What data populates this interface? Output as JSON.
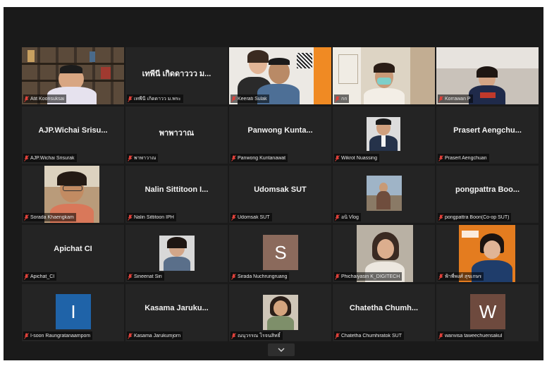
{
  "participants": [
    {
      "display": "",
      "label": "Atit Koonsuksai",
      "kind": "video-bookshelf",
      "active": true
    },
    {
      "display": "เทพีนี เกิดดาววว ม...",
      "label": "เทพีนี เกิดดาวว ม.พระ",
      "kind": "name"
    },
    {
      "display": "",
      "label": "Keerati Sulak",
      "kind": "video-coop"
    },
    {
      "display": "",
      "label": "กก",
      "kind": "video-mask"
    },
    {
      "display": "",
      "label": "Korrawan P",
      "kind": "video-room"
    },
    {
      "display": "AJP.Wichai Srisu...",
      "label": "AJP.Wichai Srisurak",
      "kind": "name"
    },
    {
      "display": "พาพาวาณ",
      "label": "พาพาวาณ",
      "kind": "name"
    },
    {
      "display": "Panwong Kunta...",
      "label": "Panwong Kuntanawat",
      "kind": "name"
    },
    {
      "display": "",
      "label": "Wikrot Nuassing",
      "kind": "photo-suit"
    },
    {
      "display": "Prasert Aengchu...",
      "label": "Prasert Aengchuan",
      "kind": "name"
    },
    {
      "display": "",
      "label": "Sorada Khaengkam",
      "kind": "photo-glasses"
    },
    {
      "display": "Nalin Sittitoon I...",
      "label": "Nalin Sittitoon IPH",
      "kind": "name"
    },
    {
      "display": "Udomsak SUT",
      "label": "Udomsak SUT",
      "kind": "name"
    },
    {
      "display": "",
      "label": "อนิ Vlog",
      "kind": "photo-outdoor"
    },
    {
      "display": "pongpattra Boo...",
      "label": "pongpattra Boon(Co-op SUT)",
      "kind": "name"
    },
    {
      "display": "Apichat CI",
      "label": "Apichat_CI",
      "kind": "name"
    },
    {
      "display": "",
      "label": "Sineenat Siri",
      "kind": "photo-sineenat"
    },
    {
      "display": "S",
      "label": "Sirada Nuchrungruang",
      "kind": "letter",
      "color": "#8b6a5c"
    },
    {
      "display": "",
      "label": "Phichaiyasin K_DIGITECH",
      "kind": "photo-woman"
    },
    {
      "display": "",
      "label": "ฟ้าพี่พงศ์ สุขเกษร",
      "kind": "photo-orange"
    },
    {
      "display": "I",
      "label": "I-soon Raungratanaampom",
      "kind": "letter",
      "color": "#1f63a8"
    },
    {
      "display": "Kasama Jaruku...",
      "label": "Kasama Jarukumjorn",
      "kind": "name"
    },
    {
      "display": "",
      "label": "ณนุวรรณ โรจนสิทธิ์",
      "kind": "photo-ganya"
    },
    {
      "display": "Chatetha Chumh...",
      "label": "Chatetha Chumhiratok SUT",
      "kind": "name"
    },
    {
      "display": "W",
      "label": "wanvisa taweechuensakul",
      "kind": "letter",
      "color": "#6e4a3e"
    }
  ],
  "icons": {
    "mic": "mic-muted-icon",
    "scroll": "chevron-down-icon"
  },
  "colors": {
    "active_speaker": "#d9e33b",
    "muted": "#e0413a",
    "tile_bg": "#242424"
  }
}
